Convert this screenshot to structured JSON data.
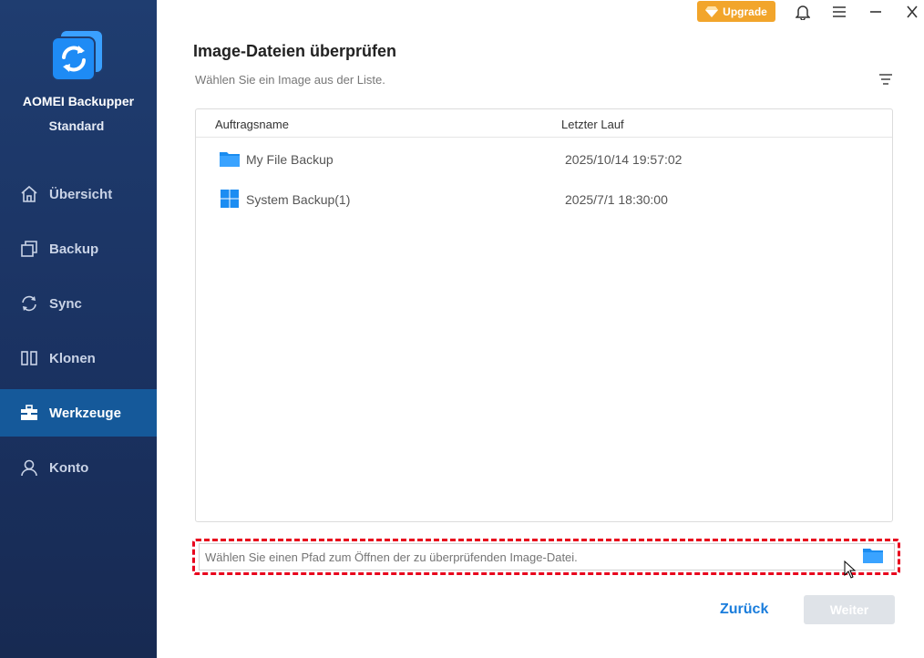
{
  "sidebar": {
    "app_name": "AOMEI Backupper",
    "edition": "Standard",
    "items": [
      {
        "label": "Übersicht",
        "icon": "home-icon"
      },
      {
        "label": "Backup",
        "icon": "backup-icon"
      },
      {
        "label": "Sync",
        "icon": "sync-icon"
      },
      {
        "label": "Klonen",
        "icon": "clone-icon"
      },
      {
        "label": "Werkzeuge",
        "icon": "toolbox-icon",
        "active": true
      },
      {
        "label": "Konto",
        "icon": "user-icon"
      }
    ]
  },
  "topbar": {
    "upgrade_label": "Upgrade"
  },
  "main": {
    "title": "Image-Dateien überprüfen",
    "subtitle": "Wählen Sie ein Image aus der Liste.",
    "columns": {
      "name": "Auftragsname",
      "last_run": "Letzter Lauf"
    },
    "rows": [
      {
        "name": "My File Backup",
        "last_run": "2025/10/14 19:57:02",
        "icon": "folder-icon"
      },
      {
        "name": "System Backup(1)",
        "last_run": "2025/7/1 18:30:00",
        "icon": "windows-icon"
      }
    ],
    "path_placeholder": "Wählen Sie einen Pfad zum Öffnen der zu überprüfenden Image-Datei."
  },
  "footer": {
    "back_label": "Zurück",
    "next_label": "Weiter"
  },
  "colors": {
    "sidebar_bg": "#1c3566",
    "active_item": "#15599a",
    "accent": "#1a7ddc",
    "upgrade": "#f2a52b",
    "highlight_dash": "#e8001c"
  }
}
